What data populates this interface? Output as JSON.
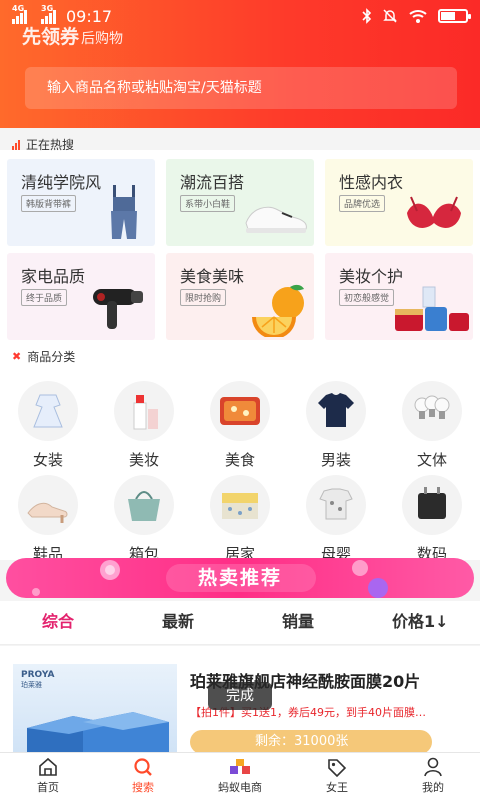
{
  "status_bar": {
    "network1": "4G",
    "network2": "3G",
    "time": "09:17"
  },
  "header": {
    "brand": "先领券",
    "brand_sub": "后购物",
    "search_placeholder": "输入商品名称或粘贴淘宝/天猫标题"
  },
  "hot": {
    "title": "正在热搜",
    "items": [
      {
        "title": "清纯学院风",
        "tag": "韩版背带裤",
        "icon": "overalls-icon"
      },
      {
        "title": "潮流百搭",
        "tag": "系带小白鞋",
        "icon": "sneaker-icon"
      },
      {
        "title": "性感内衣",
        "tag": "品牌优选",
        "icon": "bra-icon"
      },
      {
        "title": "家电品质",
        "tag": "终于品质",
        "icon": "hair-dryer-icon"
      },
      {
        "title": "美食美味",
        "tag": "限时抢购",
        "icon": "orange-icon"
      },
      {
        "title": "美妆个护",
        "tag": "初恋般感觉",
        "icon": "cosmetics-icon"
      }
    ]
  },
  "categories": {
    "title": "商品分类",
    "items": [
      {
        "label": "女装",
        "icon": "dress-icon"
      },
      {
        "label": "美妆",
        "icon": "lotion-icon"
      },
      {
        "label": "美食",
        "icon": "snack-icon"
      },
      {
        "label": "男装",
        "icon": "tshirt-icon"
      },
      {
        "label": "文体",
        "icon": "bulb-icon"
      },
      {
        "label": "鞋品",
        "icon": "heel-icon"
      },
      {
        "label": "箱包",
        "icon": "handbag-icon"
      },
      {
        "label": "居家",
        "icon": "bedding-icon"
      },
      {
        "label": "母婴",
        "icon": "baby-clothes-icon"
      },
      {
        "label": "数码",
        "icon": "charger-icon"
      }
    ]
  },
  "banner": {
    "text": "热卖推荐"
  },
  "sort_tabs": [
    {
      "label": "综合"
    },
    {
      "label": "最新"
    },
    {
      "label": "销量"
    },
    {
      "label": "价格1↓"
    }
  ],
  "product": {
    "brand_mark": "PROYA",
    "brand_mark_cn": "珀莱雅",
    "title": "珀莱雅旗舰店神经酰胺面膜20片",
    "promo": "【拍1件】买1送1，券后49元，到手40片面膜…",
    "remain": "剩余：31000张"
  },
  "toast": {
    "text": "完成"
  },
  "tabbar": [
    {
      "label": "首页",
      "icon": "home-icon"
    },
    {
      "label": "搜索",
      "icon": "search-icon"
    },
    {
      "label": "蚂蚁电商",
      "icon": "ant-shop-icon"
    },
    {
      "label": "女王",
      "icon": "tag-icon"
    },
    {
      "label": "我的",
      "icon": "user-icon"
    }
  ],
  "colors": {
    "accent": "#ff4a2a",
    "active_tab": "#e3226d",
    "banner": "#ff3a8c"
  }
}
